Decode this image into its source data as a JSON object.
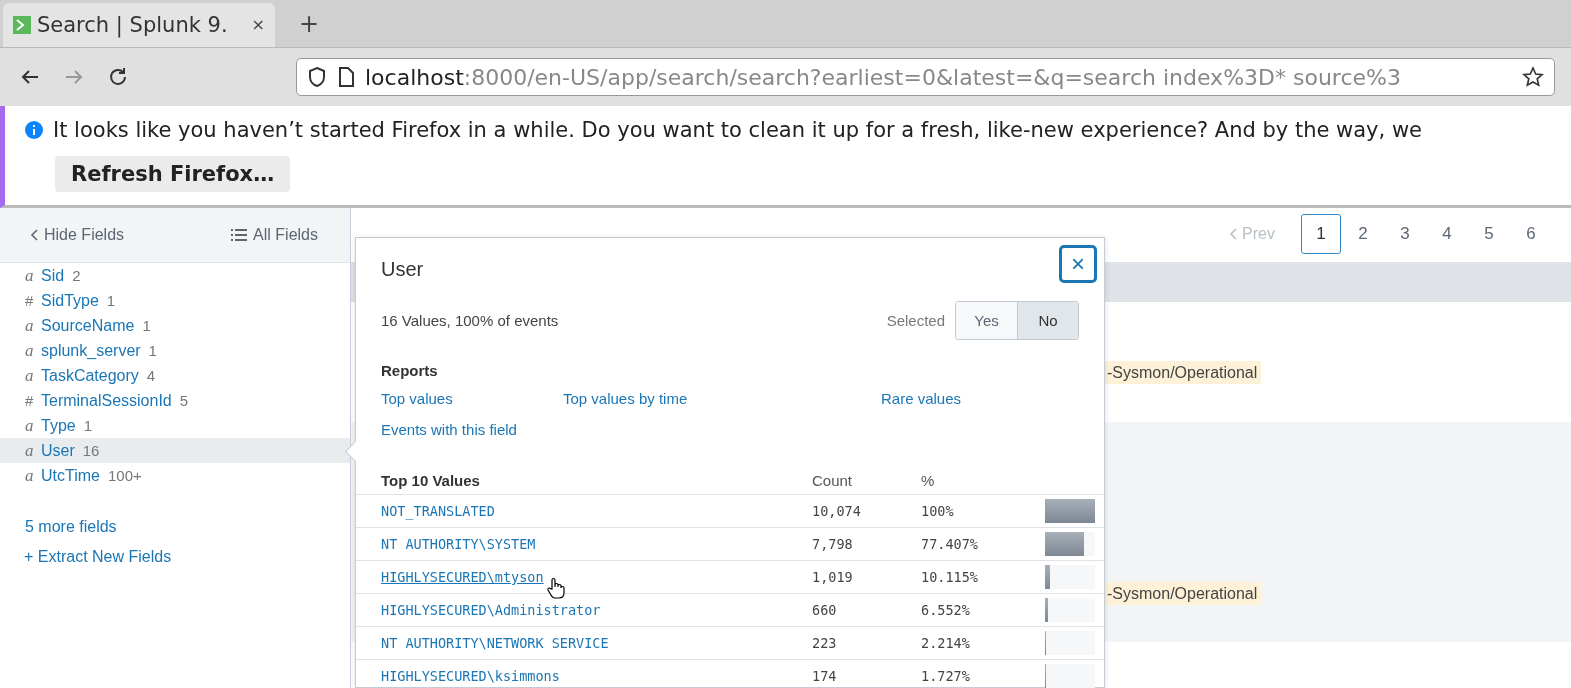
{
  "browser": {
    "tab": {
      "title": "Search | Splunk 9.",
      "close": "×"
    },
    "new_tab": "+",
    "nav": {
      "forward_disabled": true
    },
    "url": {
      "host": "localhost",
      "rest": ":8000/en-US/app/search/search?earliest=0&latest=&q=search index%3D* source%3"
    }
  },
  "notification": {
    "message": "It looks like you haven’t started Firefox in a while. Do you want to clean it up for a fresh, like-new experience? And by the way, we",
    "button": "Refresh Firefox…"
  },
  "sidebar": {
    "hide_fields": "Hide Fields",
    "all_fields": "All Fields",
    "fields": [
      {
        "type": "a",
        "name": "Sid",
        "count": "2",
        "selected": false
      },
      {
        "type": "#",
        "name": "SidType",
        "count": "1",
        "selected": false
      },
      {
        "type": "a",
        "name": "SourceName",
        "count": "1",
        "selected": false
      },
      {
        "type": "a",
        "name": "splunk_server",
        "count": "1",
        "selected": false
      },
      {
        "type": "a",
        "name": "TaskCategory",
        "count": "4",
        "selected": false
      },
      {
        "type": "#",
        "name": "TerminalSessionId",
        "count": "5",
        "selected": false
      },
      {
        "type": "a",
        "name": "Type",
        "count": "1",
        "selected": false
      },
      {
        "type": "a",
        "name": "User",
        "count": "16",
        "selected": true
      },
      {
        "type": "a",
        "name": "UtcTime",
        "count": "100+",
        "selected": false
      }
    ],
    "more_fields": "5 more fields",
    "extract": "+ Extract New Fields"
  },
  "pagination": {
    "prev": "Prev",
    "pages": [
      {
        "label": "1",
        "selected": true
      },
      {
        "label": "2",
        "selected": false
      },
      {
        "label": "3",
        "selected": false
      },
      {
        "label": "4",
        "selected": false
      },
      {
        "label": "5",
        "selected": false
      },
      {
        "label": "6",
        "selected": false
      }
    ]
  },
  "events": [
    {
      "source": "-Sysmon/Operational",
      "shaded": false
    },
    {
      "source": "-Sysmon/Operational",
      "shaded": true
    }
  ],
  "popup": {
    "title": "User",
    "close": "×",
    "summary": "16 Values, 100% of events",
    "selected_label": "Selected",
    "toggle": [
      {
        "label": "Yes",
        "selected": false
      },
      {
        "label": "No",
        "selected": true
      }
    ],
    "reports_title": "Reports",
    "reports": [
      "Top values",
      "Top values by time",
      "Rare values",
      "Events with this field"
    ],
    "table": {
      "columns": [
        "Top 10 Values",
        "Count",
        "%"
      ],
      "rows": [
        {
          "value": "NOT_TRANSLATED",
          "count": "10,074",
          "percent": "100%",
          "level": 1,
          "hovered": false
        },
        {
          "value": "NT AUTHORITY\\SYSTEM",
          "count": "7,798",
          "percent": "77.407%",
          "level": 0.774,
          "hovered": false
        },
        {
          "value": "HIGHLYSECURED\\mtyson",
          "count": "1,019",
          "percent": "10.115%",
          "level": 0.101,
          "hovered": true
        },
        {
          "value": "HIGHLYSECURED\\Administrator",
          "count": "660",
          "percent": "6.552%",
          "level": 0.066,
          "hovered": false
        },
        {
          "value": "NT AUTHORITY\\NETWORK SERVICE",
          "count": "223",
          "percent": "2.214%",
          "level": 0.022,
          "hovered": false
        },
        {
          "value": "HIGHLYSECURED\\ksimmons",
          "count": "174",
          "percent": "1.727%",
          "level": 0.017,
          "hovered": false
        }
      ]
    }
  }
}
